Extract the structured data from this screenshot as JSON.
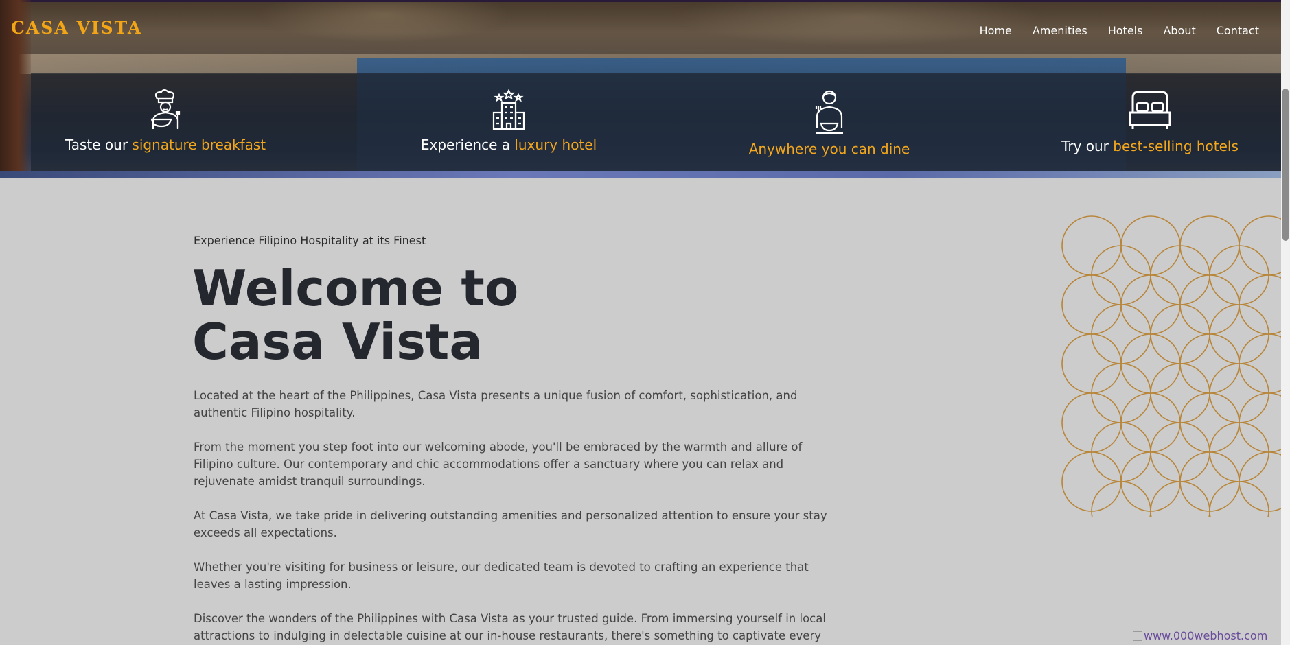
{
  "brand": {
    "logo_text": "CASA VISTA"
  },
  "nav": {
    "items": [
      "Home",
      "Amenities",
      "Hotels",
      "About",
      "Contact"
    ]
  },
  "features": [
    {
      "icon": "chef-icon",
      "prefix": "Taste our ",
      "highlight": "signature breakfast",
      "suffix": ""
    },
    {
      "icon": "hotel-building-icon",
      "prefix": "Experience a ",
      "highlight": "luxury hotel",
      "suffix": ""
    },
    {
      "icon": "dining-person-icon",
      "prefix": "",
      "highlight": "Anywhere you can dine",
      "suffix": ""
    },
    {
      "icon": "bed-icon",
      "prefix": "Try our ",
      "highlight": "best-selling hotels",
      "suffix": ""
    }
  ],
  "intro": {
    "tagline": "Experience Filipino Hospitality at its Finest",
    "headline_line1": "Welcome to",
    "headline_line2": "Casa Vista",
    "paragraphs": [
      "Located at the heart of the Philippines, Casa Vista presents a unique fusion of comfort, sophistication, and authentic Filipino hospitality.",
      "From the moment you step foot into our welcoming abode, you'll be embraced by the warmth and allure of Filipino culture. Our contemporary and chic accommodations offer a sanctuary where you can relax and rejuvenate amidst tranquil surroundings.",
      "At Casa Vista, we take pride in delivering outstanding amenities and personalized attention to ensure your stay exceeds all expectations.",
      "Whether you're visiting for business or leisure, our dedicated team is devoted to crafting an experience that leaves a lasting impression.",
      "Discover the wonders of the Philippines with Casa Vista as your trusted guide. From immersing yourself in local attractions to indulging in delectable cuisine at our in-house restaurants, there's something to captivate every"
    ]
  },
  "footer_badge": {
    "alt_text": "www.000webhost.com"
  },
  "colors": {
    "accent": "#f4a71c",
    "heading": "#24272d",
    "body_text": "#444444",
    "circle_pattern": "#b8863a",
    "page_bg": "#e6e6e6"
  }
}
